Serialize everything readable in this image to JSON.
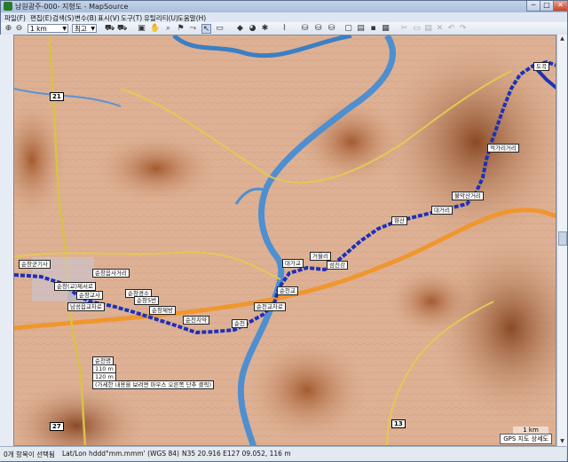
{
  "window": {
    "title": "남원광주-000- 지형도 - MapSource",
    "buttons": {
      "minimize": "─",
      "maximize": "□",
      "close": "✕"
    }
  },
  "menu": [
    "파일(F)",
    "편집(E)",
    "검색(S)",
    "변수(B)",
    "표시(V)",
    "도구(T)",
    "유틸리티(U)",
    "도움말(H)"
  ],
  "toolbar": {
    "zoom_value": "1 km",
    "detail_value": "최고",
    "icons": [
      "zoom-in-icon",
      "zoom-out-icon",
      "gps-icon",
      "product-icon",
      "map-select-icon",
      "pan-icon",
      "zoom-tool-icon",
      "waypoint-icon",
      "route-icon",
      "track-icon",
      "select-icon",
      "distance-icon",
      "recalc-icon",
      "color-icon",
      "find-icon",
      "send-icon",
      "receive-icon",
      "new-icon",
      "open-icon",
      "save-icon",
      "print-icon",
      "cut-icon",
      "copy-icon",
      "paste-icon",
      "delete-icon",
      "undo-icon",
      "redo-icon"
    ]
  },
  "map": {
    "labels": [
      {
        "text": "순창"
      },
      {
        "text": "순창군기사"
      },
      {
        "text": "남성읍교차로"
      },
      {
        "text": "순창읍사거리"
      },
      {
        "text": "순창(교)제서로"
      },
      {
        "text": "순창경소"
      },
      {
        "text": "순창제방"
      },
      {
        "text": "순창5번"
      },
      {
        "text": "순창교사"
      },
      {
        "text": "순천"
      },
      {
        "text": "순천치약"
      },
      {
        "text": "순천교차로"
      },
      {
        "text": "순천교"
      },
      {
        "text": "섬진강"
      },
      {
        "text": "풍산면교"
      },
      {
        "text": "대가교"
      },
      {
        "text": "향산"
      },
      {
        "text": "거울리"
      },
      {
        "text": "불악산거리"
      },
      {
        "text": "방원사거리"
      },
      {
        "text": "적서마곡"
      },
      {
        "text": "평원리"
      },
      {
        "text": "대거리"
      },
      {
        "text": "적가리거리"
      },
      {
        "text": "도곡"
      }
    ],
    "road_shields": [
      "21",
      "13",
      "27",
      "13"
    ],
    "info_lines": [
      "순천명",
      "110 m",
      "120 m",
      "(가세한 내용을 보려면 마우스 오른쪽 단추 클릭)"
    ],
    "scale": "1 km",
    "gps_label": "GPS 지도 상세도"
  },
  "status": {
    "selected": "0개 항목이 선택됨",
    "format": "Lat/Lon hddd°mm.mmm' (WGS 84)",
    "coords": "N35 20.916 E127 09.052, 116 m"
  }
}
